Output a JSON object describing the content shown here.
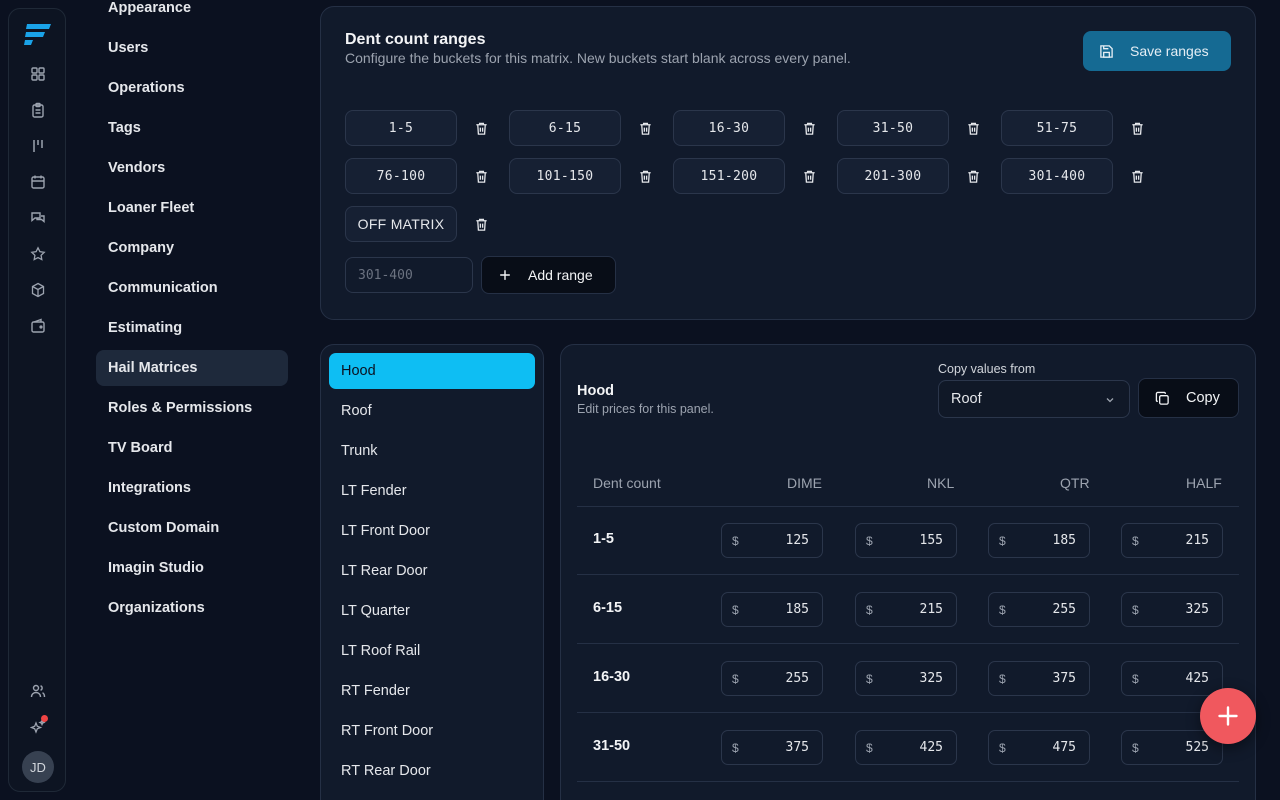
{
  "nav": {
    "items": [
      {
        "label": "Appearance"
      },
      {
        "label": "Users"
      },
      {
        "label": "Operations"
      },
      {
        "label": "Tags"
      },
      {
        "label": "Vendors"
      },
      {
        "label": "Loaner Fleet"
      },
      {
        "label": "Company"
      },
      {
        "label": "Communication"
      },
      {
        "label": "Estimating"
      },
      {
        "label": "Hail Matrices"
      },
      {
        "label": "Roles & Permissions"
      },
      {
        "label": "TV Board"
      },
      {
        "label": "Integrations"
      },
      {
        "label": "Custom Domain"
      },
      {
        "label": "Imagin Studio"
      },
      {
        "label": "Organizations"
      }
    ],
    "active": "Hail Matrices"
  },
  "rail": {
    "icons": [
      "dashboard-icon",
      "clipboard-icon",
      "board-icon",
      "calendar-icon",
      "chat-icon",
      "star-icon",
      "box-icon",
      "wallet-icon",
      "users-icon",
      "sparkles-icon"
    ],
    "notification_color": "#ef4444",
    "avatar_initials": "JD"
  },
  "ranges": {
    "title": "Dent count ranges",
    "subtitle": "Configure the buckets for this matrix. New buckets start blank across every panel.",
    "save_label": "Save ranges",
    "rows": [
      [
        "1-5",
        "6-15",
        "16-30",
        "31-50",
        "51-75"
      ],
      [
        "76-100",
        "101-150",
        "151-200",
        "201-300",
        "301-400"
      ],
      [
        "OFF MATRIX"
      ]
    ],
    "new_range_placeholder": "301-400",
    "add_label": "Add range"
  },
  "panels": {
    "items": [
      "Hood",
      "Roof",
      "Trunk",
      "LT Fender",
      "LT Front Door",
      "LT Rear Door",
      "LT Quarter",
      "LT Roof Rail",
      "RT Fender",
      "RT Front Door",
      "RT Rear Door"
    ],
    "active": "Hood"
  },
  "matrix": {
    "title": "Hood",
    "subtitle": "Edit prices for this panel.",
    "copy_from_label": "Copy values from",
    "copy_from_value": "Roof",
    "copy_label": "Copy",
    "columns": [
      "Dent count",
      "DIME",
      "NKL",
      "QTR",
      "HALF"
    ],
    "currency": "$",
    "rows": [
      {
        "label": "1-5",
        "values": [
          "125",
          "155",
          "185",
          "215"
        ]
      },
      {
        "label": "6-15",
        "values": [
          "185",
          "215",
          "255",
          "325"
        ]
      },
      {
        "label": "16-30",
        "values": [
          "255",
          "325",
          "375",
          "425"
        ]
      },
      {
        "label": "31-50",
        "values": [
          "375",
          "425",
          "475",
          "525"
        ]
      }
    ]
  },
  "colors": {
    "accent": "#0ebef3",
    "save_button": "#156a93",
    "fab": "#f0585e"
  }
}
